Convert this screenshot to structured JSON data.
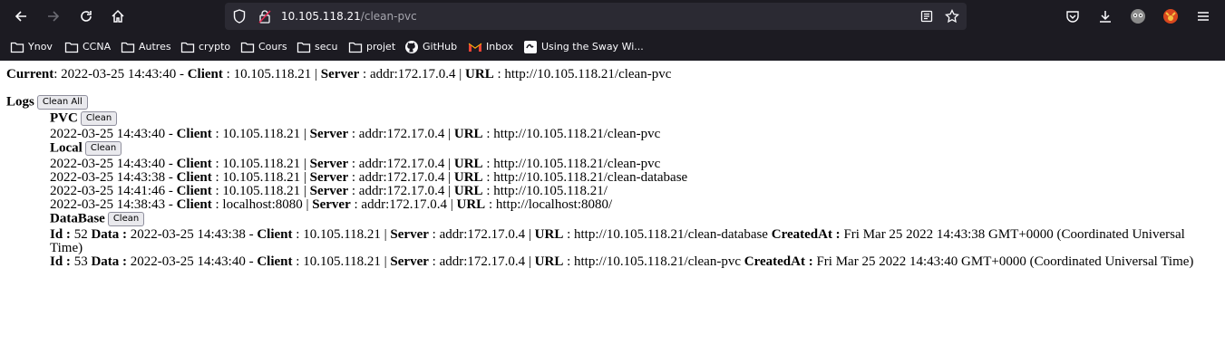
{
  "browser": {
    "url_host": "10.105.118.21",
    "url_path": "/clean-pvc",
    "bookmarks": [
      {
        "label": "Ynov",
        "icon": "folder-icon"
      },
      {
        "label": "CCNA",
        "icon": "folder-icon"
      },
      {
        "label": "Autres",
        "icon": "folder-icon"
      },
      {
        "label": "crypto",
        "icon": "folder-icon"
      },
      {
        "label": "Cours",
        "icon": "folder-icon"
      },
      {
        "label": "secu",
        "icon": "folder-icon"
      },
      {
        "label": "projet",
        "icon": "folder-icon"
      },
      {
        "label": "GitHub",
        "icon": "github-icon"
      },
      {
        "label": "Inbox",
        "icon": "gmail-icon"
      },
      {
        "label": "Using the Sway Wi...",
        "icon": "sway-icon"
      }
    ]
  },
  "labels": {
    "current": "Current",
    "client": "Client",
    "server": "Server",
    "url": "URL",
    "logs": "Logs",
    "clean_all": "Clean All",
    "clean": "Clean",
    "id": "Id :",
    "data": "Data :",
    "created_at": "CreatedAt :"
  },
  "current": {
    "date": "2022-03-25 14:43:40",
    "client": "10.105.118.21",
    "server": "addr:172.17.0.4",
    "url": "http://10.105.118.21/clean-pvc"
  },
  "pvc": {
    "title": "PVC",
    "entries": [
      {
        "date": "2022-03-25 14:43:40",
        "client": "10.105.118.21",
        "server": "addr:172.17.0.4",
        "url": "http://10.105.118.21/clean-pvc"
      }
    ]
  },
  "local": {
    "title": "Local",
    "entries": [
      {
        "date": "2022-03-25 14:43:40",
        "client": "10.105.118.21",
        "server": "addr:172.17.0.4",
        "url": "http://10.105.118.21/clean-pvc"
      },
      {
        "date": "2022-03-25 14:43:38",
        "client": "10.105.118.21",
        "server": "addr:172.17.0.4",
        "url": "http://10.105.118.21/clean-database"
      },
      {
        "date": "2022-03-25 14:41:46",
        "client": "10.105.118.21",
        "server": "addr:172.17.0.4",
        "url": "http://10.105.118.21/"
      },
      {
        "date": "2022-03-25 14:38:43",
        "client": "localhost:8080",
        "server": "addr:172.17.0.4",
        "url": "http://localhost:8080/"
      }
    ]
  },
  "database": {
    "title": "DataBase",
    "entries": [
      {
        "id": "52",
        "date": "2022-03-25 14:43:38",
        "client": "10.105.118.21",
        "server": "addr:172.17.0.4",
        "url": "http://10.105.118.21/clean-database",
        "created_at": "Fri Mar 25 2022 14:43:38 GMT+0000 (Coordinated Universal",
        "created_at_wrap": "Time)"
      },
      {
        "id": "53",
        "date": "2022-03-25 14:43:40",
        "client": "10.105.118.21",
        "server": "addr:172.17.0.4",
        "url": "http://10.105.118.21/clean-pvc",
        "created_at": "Fri Mar 25 2022 14:43:40 GMT+0000 (Coordinated Universal Time)"
      }
    ]
  }
}
